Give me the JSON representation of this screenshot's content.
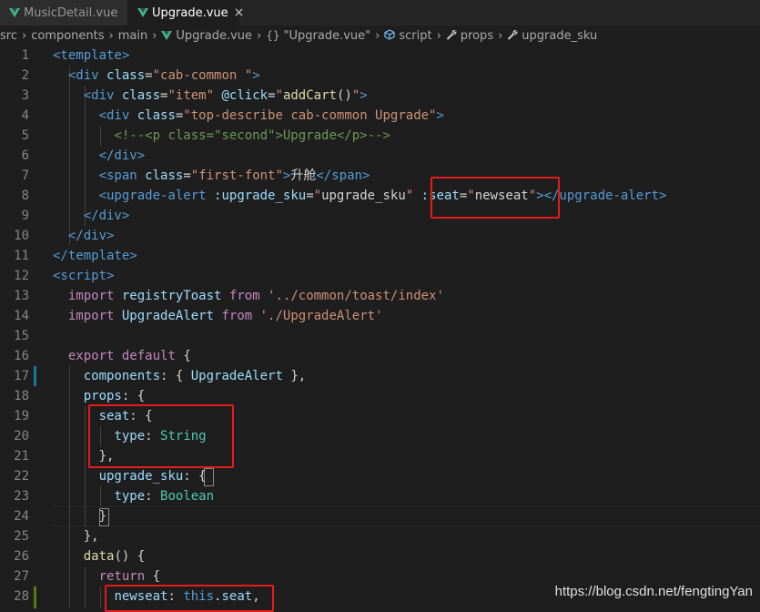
{
  "tabs": [
    {
      "label": "MusicDetail.vue",
      "active": false
    },
    {
      "label": "Upgrade.vue",
      "active": true,
      "close": "×"
    }
  ],
  "breadcrumb": {
    "items": [
      "src",
      "components",
      "main",
      "Upgrade.vue",
      "\"Upgrade.vue\"",
      "script",
      "props",
      "upgrade_sku"
    ],
    "separator": "›",
    "braces": "{}"
  },
  "code": {
    "line_numbers": [
      "1",
      "2",
      "3",
      "4",
      "5",
      "6",
      "7",
      "8",
      "9",
      "10",
      "11",
      "12",
      "13",
      "14",
      "15",
      "16",
      "17",
      "18",
      "19",
      "20",
      "21",
      "22",
      "23",
      "24",
      "25",
      "26",
      "27",
      "28"
    ],
    "lines": [
      [
        [
          "t-tag",
          "<template>"
        ]
      ],
      [
        [
          "t-text",
          "  "
        ],
        [
          "t-tag",
          "<div"
        ],
        [
          "t-text",
          " "
        ],
        [
          "t-attr",
          "class"
        ],
        [
          "t-text",
          "="
        ],
        [
          "t-str",
          "\"cab-common \""
        ],
        [
          "t-tag",
          ">"
        ]
      ],
      [
        [
          "t-text",
          "    "
        ],
        [
          "t-tag",
          "<div"
        ],
        [
          "t-text",
          " "
        ],
        [
          "t-attr",
          "class"
        ],
        [
          "t-text",
          "="
        ],
        [
          "t-str",
          "\"item\""
        ],
        [
          "t-text",
          " "
        ],
        [
          "t-attr",
          "@click"
        ],
        [
          "t-text",
          "="
        ],
        [
          "t-str",
          "\""
        ],
        [
          "t-fn",
          "addCart"
        ],
        [
          "t-text",
          "()"
        ],
        [
          "t-str",
          "\""
        ],
        [
          "t-tag",
          ">"
        ]
      ],
      [
        [
          "t-text",
          "      "
        ],
        [
          "t-tag",
          "<div"
        ],
        [
          "t-text",
          " "
        ],
        [
          "t-attr",
          "class"
        ],
        [
          "t-text",
          "="
        ],
        [
          "t-str",
          "\"top-describe cab-common Upgrade\""
        ],
        [
          "t-tag",
          ">"
        ]
      ],
      [
        [
          "t-text",
          "        "
        ],
        [
          "t-cmt",
          "<!--<p class=\"second\">Upgrade</p>-->"
        ]
      ],
      [
        [
          "t-text",
          "      "
        ],
        [
          "t-tag",
          "</div>"
        ]
      ],
      [
        [
          "t-text",
          "      "
        ],
        [
          "t-tag",
          "<span"
        ],
        [
          "t-text",
          " "
        ],
        [
          "t-attr",
          "class"
        ],
        [
          "t-text",
          "="
        ],
        [
          "t-str",
          "\"first-font\""
        ],
        [
          "t-tag",
          ">"
        ],
        [
          "t-text",
          "升舱"
        ],
        [
          "t-tag",
          "</span>"
        ]
      ],
      [
        [
          "t-text",
          "      "
        ],
        [
          "t-tag",
          "<upgrade-alert"
        ],
        [
          "t-text",
          " "
        ],
        [
          "t-attr",
          ":upgrade_sku"
        ],
        [
          "t-text",
          "="
        ],
        [
          "t-str",
          "\""
        ],
        [
          "t-text",
          "upgrade_sku"
        ],
        [
          "t-str",
          "\""
        ],
        [
          "t-text",
          " "
        ],
        [
          "t-attr",
          ":seat"
        ],
        [
          "t-text",
          "="
        ],
        [
          "t-str",
          "\""
        ],
        [
          "t-text",
          "newseat"
        ],
        [
          "t-str",
          "\""
        ],
        [
          "t-tag",
          "></upgrade-alert>"
        ]
      ],
      [
        [
          "t-text",
          "    "
        ],
        [
          "t-tag",
          "</div>"
        ]
      ],
      [
        [
          "t-text",
          "  "
        ],
        [
          "t-tag",
          "</div>"
        ]
      ],
      [
        [
          "t-tag",
          "</template>"
        ]
      ],
      [
        [
          "t-tag",
          "<script>"
        ]
      ],
      [
        [
          "t-text",
          "  "
        ],
        [
          "t-kw",
          "import"
        ],
        [
          "t-text",
          " "
        ],
        [
          "t-ident",
          "registryToast"
        ],
        [
          "t-text",
          " "
        ],
        [
          "t-kw",
          "from"
        ],
        [
          "t-text",
          " "
        ],
        [
          "t-str",
          "'../common/toast/index'"
        ]
      ],
      [
        [
          "t-text",
          "  "
        ],
        [
          "t-kw",
          "import"
        ],
        [
          "t-text",
          " "
        ],
        [
          "t-ident",
          "UpgradeAlert"
        ],
        [
          "t-text",
          " "
        ],
        [
          "t-kw",
          "from"
        ],
        [
          "t-text",
          " "
        ],
        [
          "t-str",
          "'./UpgradeAlert'"
        ]
      ],
      [],
      [
        [
          "t-text",
          "  "
        ],
        [
          "t-kw",
          "export"
        ],
        [
          "t-text",
          " "
        ],
        [
          "t-kw",
          "default"
        ],
        [
          "t-text",
          " {"
        ]
      ],
      [
        [
          "t-text",
          "    "
        ],
        [
          "t-ident",
          "components"
        ],
        [
          "t-text",
          ": { "
        ],
        [
          "t-ident",
          "UpgradeAlert"
        ],
        [
          "t-text",
          " },"
        ]
      ],
      [
        [
          "t-text",
          "    "
        ],
        [
          "t-ident",
          "props"
        ],
        [
          "t-text",
          ": {"
        ]
      ],
      [
        [
          "t-text",
          "      "
        ],
        [
          "t-ident",
          "seat"
        ],
        [
          "t-text",
          ": {"
        ]
      ],
      [
        [
          "t-text",
          "        "
        ],
        [
          "t-ident",
          "type"
        ],
        [
          "t-text",
          ": "
        ],
        [
          "t-type",
          "String"
        ]
      ],
      [
        [
          "t-text",
          "      },"
        ]
      ],
      [
        [
          "t-text",
          "      "
        ],
        [
          "t-ident",
          "upgrade_sku"
        ],
        [
          "t-text",
          ": {"
        ]
      ],
      [
        [
          "t-text",
          "        "
        ],
        [
          "t-ident",
          "type"
        ],
        [
          "t-text",
          ": "
        ],
        [
          "t-type",
          "Boolean"
        ]
      ],
      [
        [
          "t-text",
          "      }"
        ]
      ],
      [
        [
          "t-text",
          "    },"
        ]
      ],
      [
        [
          "t-text",
          "    "
        ],
        [
          "t-fn",
          "data"
        ],
        [
          "t-text",
          "() {"
        ]
      ],
      [
        [
          "t-text",
          "      "
        ],
        [
          "t-kw",
          "return"
        ],
        [
          "t-text",
          " {"
        ]
      ],
      [
        [
          "t-text",
          "        "
        ],
        [
          "t-ident",
          "newseat"
        ],
        [
          "t-text",
          ": "
        ],
        [
          "t-kwb",
          "this"
        ],
        [
          "t-text",
          "."
        ],
        [
          "t-ident",
          "seat"
        ],
        [
          "t-text",
          ","
        ]
      ]
    ]
  },
  "watermark": "https://blog.csdn.net/fengtingYan",
  "colors": {
    "editor_bg": "#1e1e1e",
    "tab_bar_bg": "#252526",
    "highlight_box": "#e81b1b",
    "gutter_modified": "#0c7d9d",
    "gutter_added": "#587c0c"
  }
}
